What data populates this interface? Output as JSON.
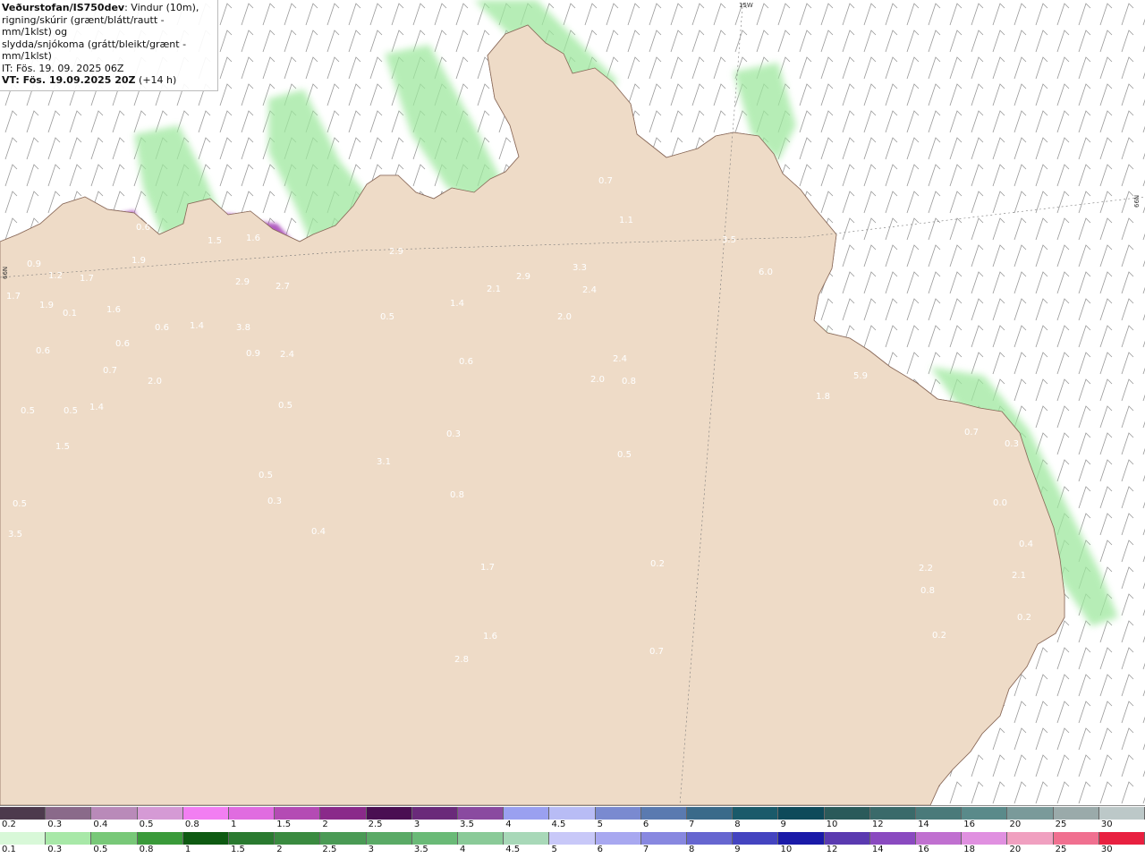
{
  "info": {
    "line1_bold": "Veðurstofan/IS750dev",
    "line1_rest": ": Vindur (10m),",
    "line2": "rigning/skúrir (grænt/blátt/rautt - mm/1klst) og",
    "line3": "slydda/snjókoma (grátt/bleikt/grænt - mm/1klst)",
    "line4": "IT: Fös. 19. 09. 2025 06Z",
    "line5_bold": "VT: Fös. 19.09.2025 20Z",
    "line5_rest": " (+14 h)"
  },
  "coords": {
    "top": "15W",
    "right": "66N",
    "left": "66N"
  },
  "colors": {
    "land": "#eedbc7",
    "sea": "#ffffff",
    "roads": "#e8734f",
    "precip_green": "#9ee89e",
    "precip_dark_green": "#2f8a3a",
    "snow_pink": "#f07ef0",
    "snow_violet": "#a341b5",
    "snow_dark": "#4a0f52",
    "snow_blue": "#9aa0f0"
  },
  "value_labels": [
    {
      "t": "0.9"
    },
    {
      "t": "1.2"
    },
    {
      "t": "1.7"
    },
    {
      "t": "1.9"
    },
    {
      "t": "0.1"
    },
    {
      "t": "1.7"
    },
    {
      "t": "1.6"
    },
    {
      "t": "0.6"
    },
    {
      "t": "0.6"
    },
    {
      "t": "0.7"
    },
    {
      "t": "0.5"
    },
    {
      "t": "0.5"
    },
    {
      "t": "1.4"
    },
    {
      "t": "1.5"
    },
    {
      "t": "0.6"
    },
    {
      "t": "1.9"
    },
    {
      "t": "0.6"
    },
    {
      "t": "1.4"
    },
    {
      "t": "2.0"
    },
    {
      "t": "1.5"
    },
    {
      "t": "1.6"
    },
    {
      "t": "2.9"
    },
    {
      "t": "2.7"
    },
    {
      "t": "3.8"
    },
    {
      "t": "0.9"
    },
    {
      "t": "2.4"
    },
    {
      "t": "0.5"
    },
    {
      "t": "0.5"
    },
    {
      "t": "0.3"
    },
    {
      "t": "0.4"
    },
    {
      "t": "0.5"
    },
    {
      "t": "3.5"
    },
    {
      "t": "2.9"
    },
    {
      "t": "0.5"
    },
    {
      "t": "1.4"
    },
    {
      "t": "0.6"
    },
    {
      "t": "0.3"
    },
    {
      "t": "3.1"
    },
    {
      "t": "0.8"
    },
    {
      "t": "1.7"
    },
    {
      "t": "1.6"
    },
    {
      "t": "2.8"
    },
    {
      "t": "2.1"
    },
    {
      "t": "2.9"
    },
    {
      "t": "3.3"
    },
    {
      "t": "2.4"
    },
    {
      "t": "2.0"
    },
    {
      "t": "2.4"
    },
    {
      "t": "2.0"
    },
    {
      "t": "0.8"
    },
    {
      "t": "0.5"
    },
    {
      "t": "0.2"
    },
    {
      "t": "0.7"
    },
    {
      "t": "0.7"
    },
    {
      "t": "1.1"
    },
    {
      "t": "3.5"
    },
    {
      "t": "6.0"
    },
    {
      "t": "1.8"
    },
    {
      "t": "5.9"
    },
    {
      "t": "0.7"
    },
    {
      "t": "0.3"
    },
    {
      "t": "0.0"
    },
    {
      "t": "0.4"
    },
    {
      "t": "2.1"
    },
    {
      "t": "2.2"
    },
    {
      "t": "0.8"
    },
    {
      "t": "0.2"
    },
    {
      "t": "0.2"
    }
  ],
  "legend_top": {
    "labels": [
      "0.2",
      "0.3",
      "0.4",
      "0.5",
      "0.8",
      "1",
      "1.5",
      "2",
      "2.5",
      "3",
      "3.5",
      "4",
      "4.5",
      "5",
      "6",
      "7",
      "8",
      "9",
      "10",
      "12",
      "14",
      "16",
      "20",
      "25",
      "30"
    ],
    "colors": [
      "#4d3a4d",
      "#8a6a8a",
      "#b98ab9",
      "#d59ad5",
      "#f27ef2",
      "#e06ce0",
      "#b44bb4",
      "#8a2a8a",
      "#4a0f52",
      "#6a2a7a",
      "#8a4aa0",
      "#9aa0f0",
      "#b8bcf5",
      "#7a8ad0",
      "#5a7ab0",
      "#3a6a8a",
      "#1a5a6a",
      "#0e4a5a",
      "#2a5a5a",
      "#3a6a6a",
      "#4a7a7a",
      "#5a8a8a",
      "#7a9a9a",
      "#9aaaaa",
      "#bcc8c8"
    ]
  },
  "legend_bottom": {
    "labels": [
      "0.1",
      "0.3",
      "0.5",
      "0.8",
      "1",
      "1.5",
      "2",
      "2.5",
      "3",
      "3.5",
      "4",
      "4.5",
      "5",
      "6",
      "7",
      "8",
      "9",
      "10",
      "12",
      "14",
      "16",
      "18",
      "20",
      "25",
      "30"
    ],
    "colors": [
      "#d8f8d8",
      "#a8e8a8",
      "#78c878",
      "#3a9a3a",
      "#0e5a12",
      "#2a7a30",
      "#3a8a40",
      "#4a9a55",
      "#5aaa66",
      "#6aba77",
      "#8aca98",
      "#a8d8b8",
      "#c8c8f8",
      "#a8a8f0",
      "#8888e0",
      "#6666d0",
      "#4444c0",
      "#1a1aa8",
      "#5a3ab0",
      "#8a4ac0",
      "#c070d0",
      "#e090e0",
      "#f0a0c0",
      "#f07090",
      "#e82040"
    ]
  }
}
